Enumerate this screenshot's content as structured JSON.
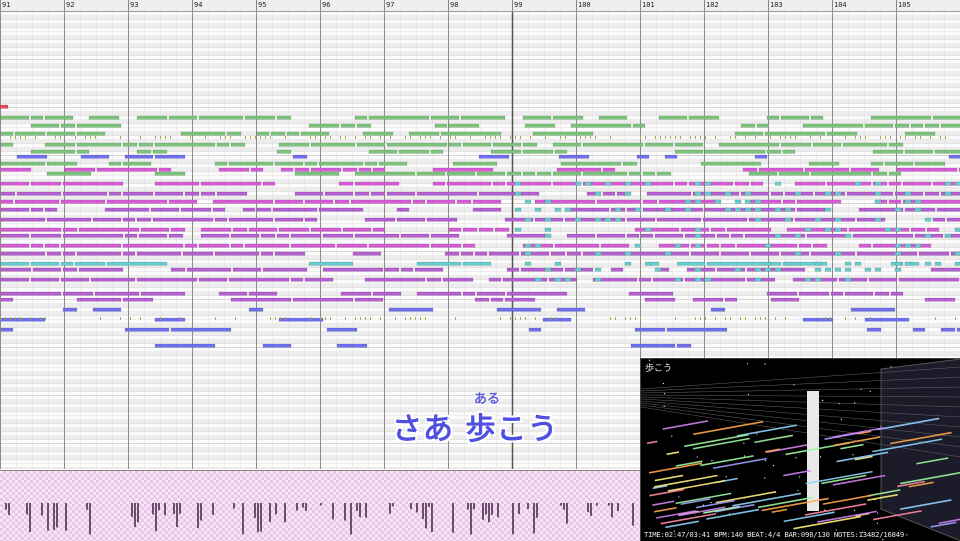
{
  "ruler": {
    "bars": [
      "91",
      "92",
      "93",
      "94",
      "95",
      "96",
      "97",
      "98",
      "99",
      "100",
      "101",
      "102",
      "103",
      "104",
      "105"
    ]
  },
  "lyrics": {
    "ruby": "ある",
    "line": "さあ 歩こう"
  },
  "preview": {
    "title": "歩こう",
    "status": "TIME:02:47/03:41 BPM:140 BEAT:4/4 BAR:098/130 NOTES:13482/16849"
  },
  "colors": {
    "green": "#7cc47c",
    "magenta": "#d75ad7",
    "purple": "#b65fd3",
    "cyan": "#66cccc",
    "blue": "#6f6ff0",
    "red": "#e64a5a",
    "gray": "#9a9a9a",
    "olive": "#a9a94a"
  }
}
